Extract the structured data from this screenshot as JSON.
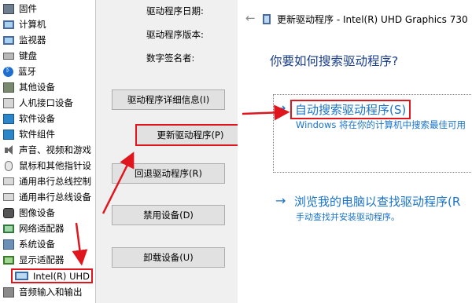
{
  "device_tree": {
    "items": [
      {
        "label": "固件",
        "icon": "firmware-icon"
      },
      {
        "label": "计算机",
        "icon": "computer-icon"
      },
      {
        "label": "监视器",
        "icon": "monitor-icon"
      },
      {
        "label": "键盘",
        "icon": "keyboard-icon"
      },
      {
        "label": "蓝牙",
        "icon": "bluetooth-icon"
      },
      {
        "label": "其他设备",
        "icon": "other-devices-icon"
      },
      {
        "label": "人机接口设备",
        "icon": "hid-icon"
      },
      {
        "label": "软件设备",
        "icon": "software-device-icon"
      },
      {
        "label": "软件组件",
        "icon": "software-component-icon"
      },
      {
        "label": "声音、视频和游戏",
        "icon": "speaker-icon"
      },
      {
        "label": "鼠标和其他指针设",
        "icon": "mouse-icon"
      },
      {
        "label": "通用串行总线控制",
        "icon": "usb-icon"
      },
      {
        "label": "通用串行总线设备",
        "icon": "usb-device-icon"
      },
      {
        "label": "图像设备",
        "icon": "camera-icon"
      },
      {
        "label": "网络适配器",
        "icon": "network-adapter-icon"
      },
      {
        "label": "系统设备",
        "icon": "system-device-icon"
      },
      {
        "label": "显示适配器",
        "icon": "display-adapter-icon"
      },
      {
        "label": "音频输入和输出",
        "icon": "audio-io-icon"
      }
    ],
    "selected_child": {
      "label": "Intel(R) UHD",
      "icon": "display-adapter-icon"
    }
  },
  "driver_panel": {
    "date_label": "驱动程序日期:",
    "version_label": "驱动程序版本:",
    "signer_label": "数字签名者:",
    "buttons": {
      "details": "驱动程序详细信息(I)",
      "update": "更新驱动程序(P)",
      "rollback": "回退驱动程序(R)",
      "disable": "禁用设备(D)",
      "uninstall": "卸载设备(U)"
    }
  },
  "wizard": {
    "back_glyph": "←",
    "title": "更新驱动程序 - Intel(R) UHD Graphics 730",
    "question": "你要如何搜索驱动程序?",
    "arrow_glyph": "→",
    "auto_search": {
      "title": "自动搜索驱动程序(S)",
      "description": "Windows 将在你的计算机中搜索最佳可用"
    },
    "browse": {
      "title": "浏览我的电脑以查找驱动程序(R",
      "description": "手动查找并安装驱动程序。"
    }
  },
  "colors": {
    "annotation_red": "#e0161e",
    "link_blue": "#1a73c9",
    "heading_blue": "#1a3e8c"
  }
}
